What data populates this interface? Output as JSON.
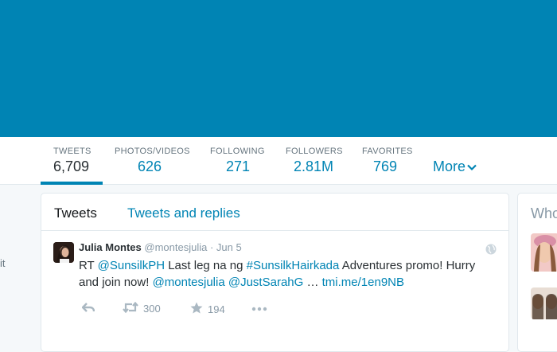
{
  "stats": [
    {
      "label": "TWEETS",
      "value": "6,709"
    },
    {
      "label": "PHOTOS/VIDEOS",
      "value": "626"
    },
    {
      "label": "FOLLOWING",
      "value": "271"
    },
    {
      "label": "FOLLOWERS",
      "value": "2.81M"
    },
    {
      "label": "FAVORITES",
      "value": "769"
    }
  ],
  "more_label": "More",
  "left_fragment": "it",
  "tabs": {
    "tweets": "Tweets",
    "replies": "Tweets and replies"
  },
  "tweet": {
    "name": "Julia Montes",
    "handle": "@montesjulia",
    "date": "· Jun 5",
    "text": {
      "rt": "RT ",
      "mention1": "@SunsilkPH",
      "mid1": " Last leg na ng ",
      "hashtag": "#SunsilkHairkada",
      "mid2": " Adventures promo! Hurry and join now! ",
      "mention2": "@montesjulia",
      "space": " ",
      "mention3": "@JustSarahG",
      "ellipsis": " … ",
      "url": "tmi.me/1en9NB"
    },
    "retweets": "300",
    "favorites": "194"
  },
  "right_title": "Who",
  "icons": {
    "reply": "reply-icon",
    "retweet": "retweet-icon",
    "favorite": "star-icon",
    "more": "more-icon",
    "globe": "globe-icon"
  },
  "colors": {
    "accent": "#0084b4",
    "banner": "#0084b4",
    "muted": "#8899a6"
  }
}
